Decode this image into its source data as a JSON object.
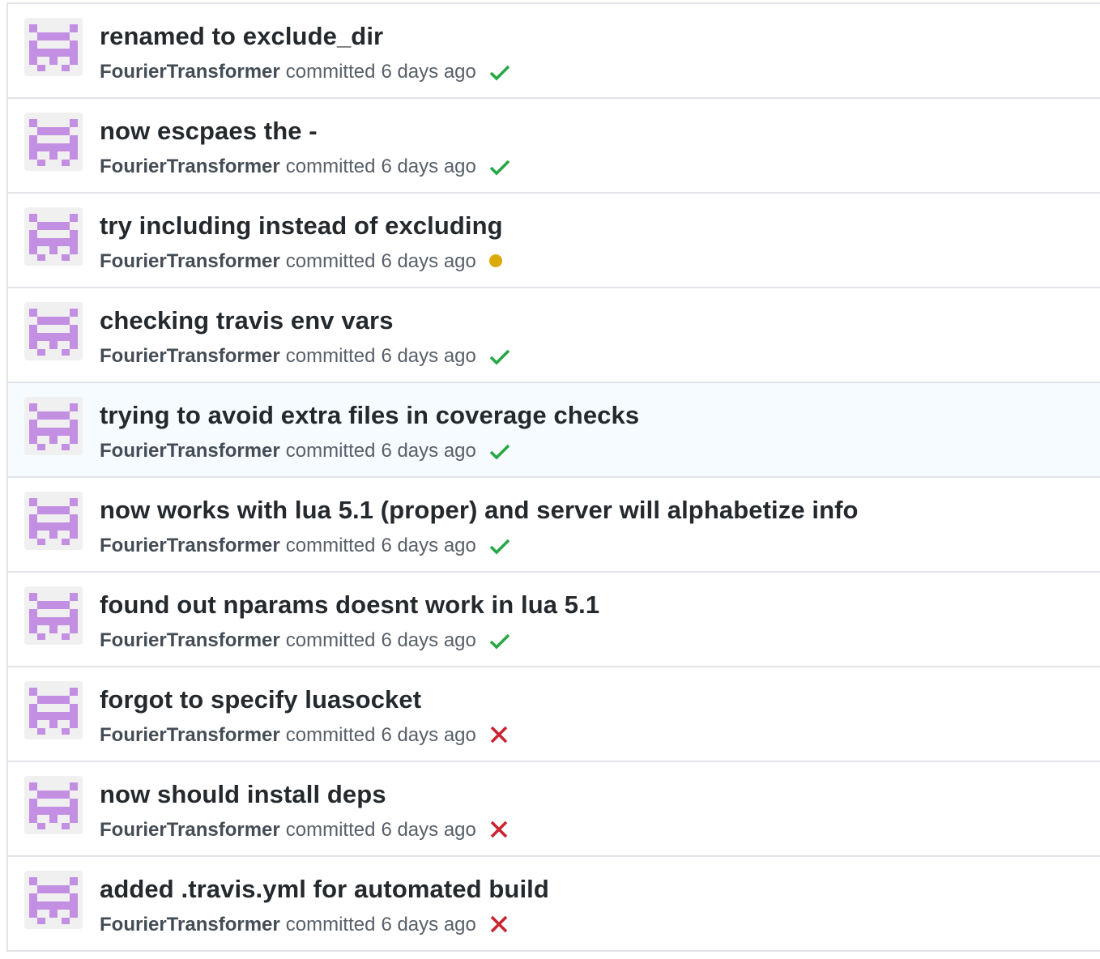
{
  "commits": [
    {
      "title": "renamed to exclude_dir",
      "author": "FourierTransformer",
      "action": "committed",
      "time": "6 days ago",
      "status": "success"
    },
    {
      "title": "now escpaes the -",
      "author": "FourierTransformer",
      "action": "committed",
      "time": "6 days ago",
      "status": "success"
    },
    {
      "title": "try including instead of excluding",
      "author": "FourierTransformer",
      "action": "committed",
      "time": "6 days ago",
      "status": "pending"
    },
    {
      "title": "checking travis env vars",
      "author": "FourierTransformer",
      "action": "committed",
      "time": "6 days ago",
      "status": "success"
    },
    {
      "title": "trying to avoid extra files in coverage checks",
      "author": "FourierTransformer",
      "action": "committed",
      "time": "6 days ago",
      "status": "success",
      "highlighted": true
    },
    {
      "title": "now works with lua 5.1 (proper) and server will alphabetize info",
      "author": "FourierTransformer",
      "action": "committed",
      "time": "6 days ago",
      "status": "success"
    },
    {
      "title": "found out nparams doesnt work in lua 5.1",
      "author": "FourierTransformer",
      "action": "committed",
      "time": "6 days ago",
      "status": "success"
    },
    {
      "title": "forgot to specify luasocket",
      "author": "FourierTransformer",
      "action": "committed",
      "time": "6 days ago",
      "status": "failure"
    },
    {
      "title": "now should install deps",
      "author": "FourierTransformer",
      "action": "committed",
      "time": "6 days ago",
      "status": "failure"
    },
    {
      "title": "added .travis.yml for automated build",
      "author": "FourierTransformer",
      "action": "committed",
      "time": "6 days ago",
      "status": "failure"
    }
  ],
  "colors": {
    "success": "#28a745",
    "pending": "#dbab09",
    "failure": "#cb2431",
    "avatar": "#c38fe3"
  },
  "icons": {
    "success": "check-icon",
    "pending": "dot-icon",
    "failure": "x-icon",
    "avatar": "identicon"
  }
}
